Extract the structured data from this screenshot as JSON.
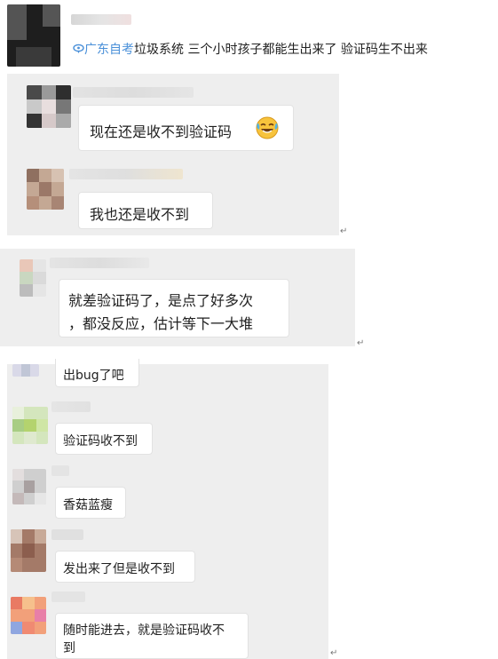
{
  "header": {
    "blurred_name": "",
    "topic_icon": "topic-icon",
    "topic_name": "广东自考",
    "message": "垃圾系统 三个小时孩子都能生出来了 验证码生不出来"
  },
  "comments": [
    {
      "text": "现在还是收不到验证码",
      "emoji": "😂"
    },
    {
      "text": "我也还是收不到"
    },
    {
      "line1": "就差验证码了，是点了好多次",
      "line2": "，都没反应，估计等下一大堆"
    },
    {
      "text": "出bug了吧"
    },
    {
      "text": "验证码收不到"
    },
    {
      "text": "香菇蓝瘦"
    },
    {
      "text": "发出来了但是收不到"
    },
    {
      "line1": "随时能进去，就是验证码收不",
      "line2": "到"
    }
  ],
  "paragraph_mark": "↵",
  "colors": {
    "panel": "#eeeeee",
    "topic": "#4a90d9",
    "bubble_border": "#e2e2e2"
  }
}
